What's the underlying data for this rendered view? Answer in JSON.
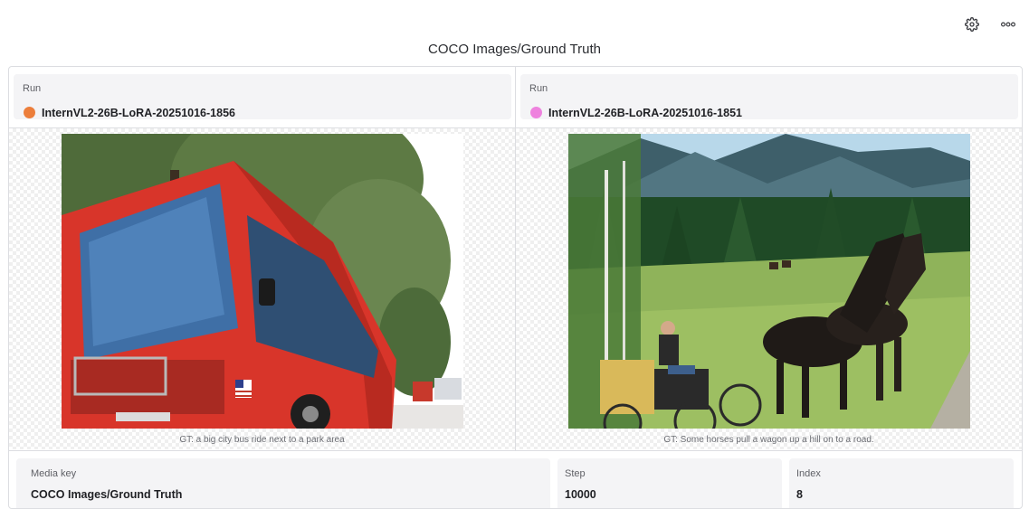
{
  "header": {
    "title": "COCO Images/Ground Truth",
    "icons": [
      "gear-icon",
      "more-icon"
    ]
  },
  "runs": [
    {
      "label": "Run",
      "name": "InternVL2-26B-LoRA-20251016-1856",
      "color": "#ec7e3b",
      "caption": "GT: a big city bus ride next to a park area"
    },
    {
      "label": "Run",
      "name": "InternVL2-26B-LoRA-20251016-1851",
      "color": "#ee82de",
      "caption": "GT: Some horses pull a wagon up a hill on to a road."
    }
  ],
  "footer": {
    "media_key_label": "Media key",
    "media_key_value": "COCO Images/Ground Truth",
    "step_label": "Step",
    "step_value": "10000",
    "index_label": "Index",
    "index_value": "8"
  }
}
